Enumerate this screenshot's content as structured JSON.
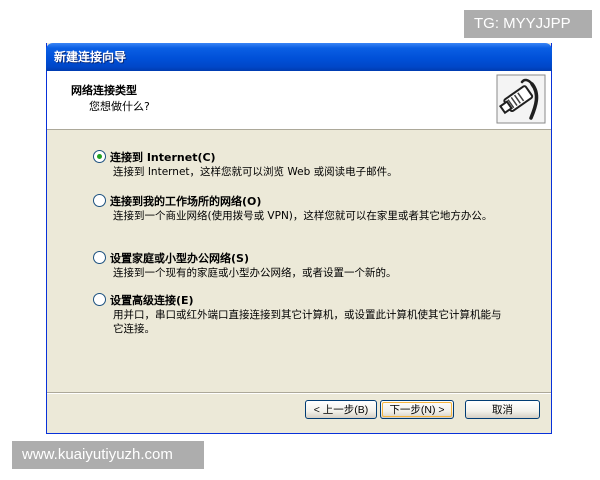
{
  "watermarks": {
    "top": "TG: MYYJJPP",
    "bottom": "www.kuaiyutiyuzh.com"
  },
  "window": {
    "title": "新建连接向导"
  },
  "header": {
    "title": "网络连接类型",
    "subtitle": "您想做什么?",
    "icon": "network-cable-plug-icon"
  },
  "options": [
    {
      "label": "连接到 Internet(C)",
      "description": "连接到 Internet，这样您就可以浏览 Web 或阅读电子邮件。",
      "checked": true
    },
    {
      "label": "连接到我的工作场所的网络(O)",
      "description": "连接到一个商业网络(使用拨号或 VPN)，这样您就可以在家里或者其它地方办公。",
      "checked": false
    },
    {
      "label": "设置家庭或小型办公网络(S)",
      "description": "连接到一个现有的家庭或小型办公网络，或者设置一个新的。",
      "checked": false
    },
    {
      "label": "设置高级连接(E)",
      "description": "用并口，串口或红外端口直接连接到其它计算机，或设置此计算机使其它计算机能与它连接。",
      "checked": false
    }
  ],
  "buttons": {
    "back": "< 上一步(B)",
    "next": "下一步(N) >",
    "cancel": "取消"
  },
  "colors": {
    "titlebar": "#0050d8",
    "dialog_bg": "#ece9d8",
    "radio_selected": "#21a121"
  }
}
